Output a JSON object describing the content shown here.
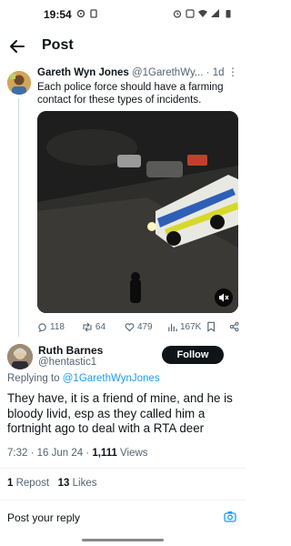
{
  "status_bar": {
    "time": "19:54"
  },
  "header": {
    "title": "Post"
  },
  "parent_post": {
    "author_name": "Gareth Wyn Jones",
    "author_handle": "@1GarethWy...",
    "separator": "·",
    "time_ago": "1d",
    "more": "⋮",
    "text": "Each police force should have a farming contact for these types of incidents.",
    "replies": "118",
    "reposts": "64",
    "likes": "479",
    "views": "167K"
  },
  "reply_post": {
    "author_name": "Ruth Barnes",
    "author_handle": "@hentastic1",
    "follow_label": "Follow",
    "replying_prefix": "Replying to",
    "replying_mention": "@1GarethWynJones",
    "text": "They have, it is a friend of mine, and he is bloody livid, esp as they called him a fortnight ago to deal with a RTA deer",
    "timestamp": "7:32 · 16 Jun 24 · ",
    "views_count": "1,111",
    "views_label": " Views",
    "repost_count": "1",
    "repost_label": " Repost",
    "likes_count": "13",
    "likes_label": " Likes"
  },
  "composer": {
    "placeholder": "Post your reply"
  },
  "colors": {
    "accent": "#1d9bf0",
    "text": "#0f1419",
    "muted": "#536471"
  },
  "icons": [
    "back-arrow-icon",
    "reply-icon",
    "repost-icon",
    "like-icon",
    "views-icon",
    "bookmark-icon",
    "share-icon",
    "mute-icon",
    "camera-icon"
  ]
}
